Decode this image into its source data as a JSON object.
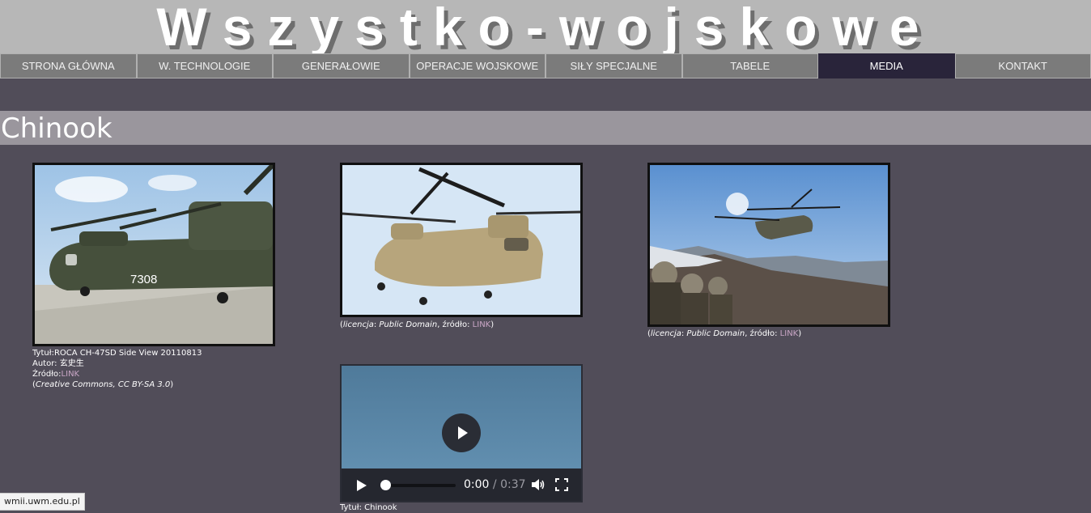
{
  "header": {
    "title": "Wszystko-wojskowe"
  },
  "nav": {
    "items": [
      {
        "label": "STRONA GŁÓWNA"
      },
      {
        "label": "W. TECHNOLOGIE"
      },
      {
        "label": "GENERAŁOWIE"
      },
      {
        "label": "OPERACJE WOJSKOWE"
      },
      {
        "label": "SIŁY SPECJALNE"
      },
      {
        "label": "TABELE"
      },
      {
        "label": "MEDIA"
      },
      {
        "label": "KONTAKT"
      }
    ],
    "active": "MEDIA"
  },
  "page": {
    "title": "Chinook"
  },
  "gallery": {
    "image1": {
      "title_prefix": "Tytuł:",
      "title": "ROCA CH-47SD Side View 20110813",
      "author_prefix": "Autor: ",
      "author": "玄史生",
      "source_prefix": "Źródło:",
      "source_link": "LINK",
      "license_open": "(",
      "license": "Creative Commons, CC BY-SA 3.0",
      "license_close": ")"
    },
    "image2": {
      "license_prefix": "(",
      "license_label": "licencja",
      "license_colon": ": ",
      "license": "Public Domain",
      "source_label": ", źródło: ",
      "source_link": "LINK",
      "close": ")"
    },
    "image3": {
      "license_prefix": "(",
      "license_label": "licencja",
      "license_colon": ": ",
      "license": "Public Domain",
      "source_label": ", źródło: ",
      "source_link": "LINK",
      "close": ")"
    },
    "video": {
      "current_time": "0:00",
      "separator": " / ",
      "duration": "0:37",
      "caption": "Tytuł: Chinook"
    }
  },
  "status_bar": {
    "url": "wmii.uwm.edu.pl"
  },
  "colors": {
    "background": "#514d59",
    "banner": "#b7b7b7",
    "nav": "#7b7b7b",
    "nav_active": "#29243a",
    "title_bar": "#9a969d",
    "link": "#c9a6c6"
  }
}
